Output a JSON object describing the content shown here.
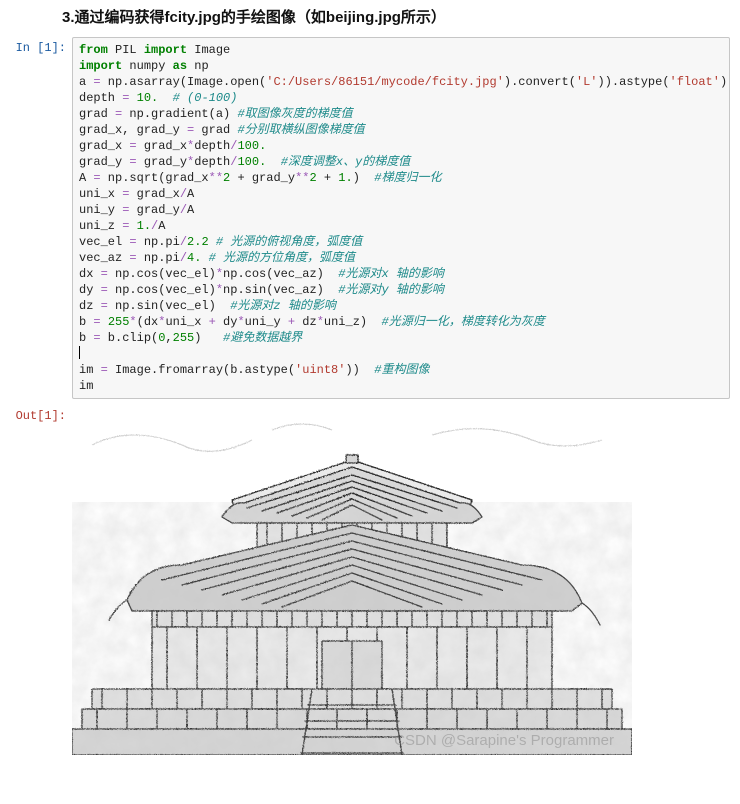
{
  "heading": "3.通过编码获得fcity.jpg的手绘图像（如beijing.jpg所示）",
  "prompt_in": "In  [1]:",
  "prompt_out": "Out[1]:",
  "watermark": "CSDN @Sarapine's Programmer",
  "code": {
    "l01": {
      "a": "from",
      "b": " PIL ",
      "c": "import",
      "d": " Image"
    },
    "l02": {
      "a": "import",
      "b": " numpy ",
      "c": "as",
      "d": " np"
    },
    "l03": "",
    "l04": {
      "a": "a ",
      "b": "=",
      "c": " np.asarray(Image.open(",
      "d": "'C:/Users/86151/mycode/fcity.jpg'",
      "e": ").convert(",
      "f": "'L'",
      "g": ")).astype(",
      "h": "'float'",
      "i": ")"
    },
    "l05": "",
    "l06": {
      "a": "depth ",
      "b": "=",
      "c": " ",
      "d": "10.",
      "e": "  ",
      "f": "# (0-100)"
    },
    "l07": {
      "a": "grad ",
      "b": "=",
      "c": " np.gradient(a) ",
      "d": "#取图像灰度的梯度值"
    },
    "l08": {
      "a": "grad_x, grad_y ",
      "b": "=",
      "c": " grad ",
      "d": "#分别取横纵图像梯度值"
    },
    "l09": {
      "a": "grad_x ",
      "b": "=",
      "c": " grad_x",
      "d": "*",
      "e": "depth",
      "f": "/",
      "g": "100."
    },
    "l10": {
      "a": "grad_y ",
      "b": "=",
      "c": " grad_y",
      "d": "*",
      "e": "depth",
      "f": "/",
      "g": "100.",
      "h": "  ",
      "i": "#深度调整x、y的梯度值"
    },
    "l11": {
      "a": "A ",
      "b": "=",
      "c": " np.sqrt(grad_x",
      "d": "**",
      "e": "2",
      "f": " + grad_y",
      "g": "**",
      "h": "2",
      "i": " + ",
      "j": "1.",
      "k": ")  ",
      "l": "#梯度归一化"
    },
    "l12": {
      "a": "uni_x ",
      "b": "=",
      "c": " grad_x",
      "d": "/",
      "e": "A"
    },
    "l13": {
      "a": "uni_y ",
      "b": "=",
      "c": " grad_y",
      "d": "/",
      "e": "A"
    },
    "l14": {
      "a": "uni_z ",
      "b": "=",
      "c": " ",
      "d": "1.",
      "e": "/",
      "f": "A"
    },
    "l15": "",
    "l16": {
      "a": "vec_el ",
      "b": "=",
      "c": " np.pi",
      "d": "/",
      "e": "2.2",
      "f": " ",
      "g": "# 光源的俯视角度，弧度值"
    },
    "l17": {
      "a": "vec_az ",
      "b": "=",
      "c": " np.pi",
      "d": "/",
      "e": "4.",
      "f": " ",
      "g": "# 光源的方位角度，弧度值"
    },
    "l18": {
      "a": "dx ",
      "b": "=",
      "c": " np.cos(vec_el)",
      "d": "*",
      "e": "np.cos(vec_az)  ",
      "f": "#光源对x 轴的影响"
    },
    "l19": {
      "a": "dy ",
      "b": "=",
      "c": " np.cos(vec_el)",
      "d": "*",
      "e": "np.sin(vec_az)  ",
      "f": "#光源对y 轴的影响"
    },
    "l20": {
      "a": "dz ",
      "b": "=",
      "c": " np.sin(vec_el)  ",
      "d": "#光源对z 轴的影响"
    },
    "l21": "",
    "l22": {
      "a": "b ",
      "b": "=",
      "c": " ",
      "d": "255",
      "e": "*",
      "f": "(dx",
      "g": "*",
      "h": "uni_x ",
      "i": "+",
      "j": " dy",
      "k": "*",
      "l": "uni_y ",
      "m": "+",
      "n": " dz",
      "o": "*",
      "p": "uni_z)  ",
      "q": "#光源归一化，梯度转化为灰度"
    },
    "l23": {
      "a": "b ",
      "b": "=",
      "c": " b.clip(",
      "d": "0",
      "e": ",",
      "f": "255",
      "g": ")   ",
      "h": "#避免数据越界"
    },
    "l24": "",
    "l25": {
      "a": "im ",
      "b": "=",
      "c": " Image.fromarray(b.astype(",
      "d": "'uint8'",
      "e": "))  ",
      "f": "#重构图像"
    },
    "l26": {
      "a": "im"
    }
  }
}
